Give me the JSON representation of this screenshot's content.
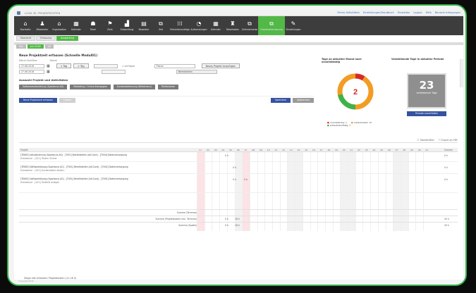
{
  "window": {
    "title": "LOGA 3E- PROJEKTKOSTEN",
    "top_links": [
      "Meine Aktivitäten",
      "Einstellungen/Handbuch",
      "Einstellen",
      "Logout",
      "Hilfe",
      "Benachrichtigungen"
    ]
  },
  "toolbar": [
    {
      "label": "Startseite",
      "glyph": "⌂"
    },
    {
      "label": "Mitarbeiter",
      "glyph": "♟"
    },
    {
      "label": "Organisation",
      "glyph": "⌂"
    },
    {
      "label": "Kalender",
      "glyph": "▦"
    },
    {
      "label": "Team",
      "glyph": "☗"
    },
    {
      "label": "Ziele",
      "glyph": "⚑"
    },
    {
      "label": "Entwicklung",
      "glyph": "▟"
    },
    {
      "label": "Bewerber",
      "glyph": "▤"
    },
    {
      "label": "Zeit",
      "glyph": "⧉"
    },
    {
      "label": "Fehlzeitenanträge",
      "glyph": "⁞⁞⁞"
    },
    {
      "label": "Aufwendungen",
      "glyph": "◔"
    },
    {
      "label": "Kalender",
      "glyph": "▦"
    },
    {
      "label": "Reisekosten",
      "glyph": "♜"
    },
    {
      "label": "Zeitnachweise",
      "glyph": "⧉"
    },
    {
      "label": "Projektzeiterfassung",
      "glyph": "⧉"
    },
    {
      "label": "Einstellungen",
      "glyph": "✎"
    }
  ],
  "subtabs": [
    "Übersicht",
    "Erfassung",
    "Auswertung"
  ],
  "crumbs": [
    "Mai",
    "Juni 2016",
    "Juli"
  ],
  "form": {
    "title": "Neue Projektzeit erfassen (Schnelle Modul01)",
    "label_date": "Datum Buchflow",
    "label_until": "Datum",
    "date1": "27.06.2016",
    "date2": "27.06.2016",
    "prev_day": "< Tag",
    "next_day": "> Tag",
    "hours_label": "h verfügbar",
    "select1": "Planen",
    "select2": "Bereitstellen",
    "add_project": "Neues Projekt hinzufügen",
    "section": "Auswahl Projekt und Aktivitäten",
    "chips": [
      "Softwareentwicklung (Spartacus AG)",
      "Marketing / Online-Kampagne",
      "Kundenbetreuung (Weidmann)",
      "Telefonieren"
    ],
    "new_btn": "Neue Projektzeit erfassen",
    "clear_btn": "Leeren",
    "save_btn": "Speichern",
    "cancel_btn": "Abbrechen"
  },
  "ring": {
    "title": "Tage an aktueller Monat noch unvollständig",
    "value": "2",
    "legend": [
      "unvollständig: 1",
      "unbearbeitet: 14",
      "erfasst/überfällig: 1"
    ]
  },
  "stat": {
    "title": "Verbleibende Tage in aktueller Periode",
    "value": "23",
    "sub": "verbleibende Tage",
    "link": "Periode anschließen"
  },
  "grid": {
    "tools": [
      "Tabellenfilter",
      "Export als PDF"
    ],
    "project_header": "Projekt",
    "sum_header": "Summe",
    "days": [
      "01",
      "02",
      "03",
      "04",
      "05",
      "06",
      "07",
      "08",
      "09",
      "10",
      "11",
      "12",
      "13",
      "14",
      "15",
      "16",
      "17",
      "18",
      "19",
      "20",
      "21",
      "22",
      "23",
      "24",
      "25",
      "26",
      "27",
      "28",
      "29",
      "30",
      "31"
    ],
    "rows": [
      {
        "line1": "[TEKKO] Aktualisierung (Spartacus AG) - [T001] Bereitstellen (Alt.Cont) - [T004] Datenversorgung",
        "line2": "Kreissteuer - [4C1] Testen Ordner",
        "val": "0 h",
        "sum": "0 h"
      },
      {
        "line1": "[TEKKO] Softwarelösung (Spartacus AG) - [T001] Bereitstellen (Alt.Cont) - [T004] Datenversorgung",
        "line2": "Kreissteuer - [4C1] Kundendaten ändern",
        "val": "0 h",
        "sum": "0 h"
      },
      {
        "line1": "[TEKKO] Softwarelösung (Spartacus AG) - [T001] Bereitstellen (Alt.Cont) - [T004] Datenversorgung",
        "line2": "Kreissteuer - [4C1] Testfeld anlegen",
        "val": "0 h",
        "sum": "0 h"
      }
    ],
    "sums": [
      {
        "label": "Summe (Termine)",
        "a": "",
        "b": "",
        "total": ""
      },
      {
        "label": "Summe (Projektkosten inkl. Termine)",
        "a": "0 h",
        "b": "18 h",
        "total": "20 h"
      },
      {
        "label": "Summe (Spalte)",
        "a": "0 h",
        "b": "18 h",
        "total": "20 h"
      }
    ]
  },
  "footer_note": "Zeige alle erfassten Projektkosten (11.16 h)",
  "statusbar": "Copyright 2016"
}
